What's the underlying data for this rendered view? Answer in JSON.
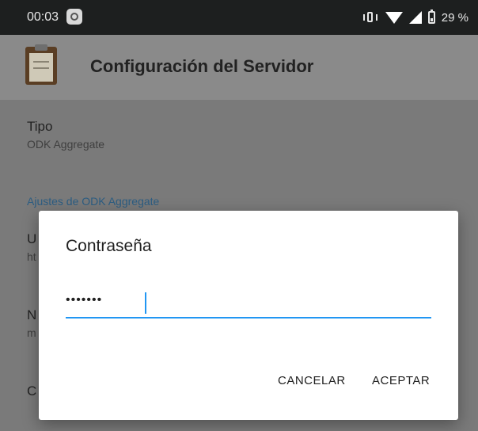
{
  "status_bar": {
    "time": "00:03",
    "battery": "29 %"
  },
  "app_bar": {
    "title": "Configuración del Servidor"
  },
  "settings": {
    "tipo": {
      "title": "Tipo",
      "summary": "ODK Aggregate"
    },
    "category": "Ajustes de ODK Aggregate",
    "url_initial": "U",
    "url_summary_initial": "ht",
    "name_initial": "N",
    "name_summary_initial": "m",
    "password_initial": "C"
  },
  "dialog": {
    "title": "Contraseña",
    "value": "•••••••",
    "cancel_label": "CANCELAR",
    "accept_label": "ACEPTAR"
  },
  "colors": {
    "accent": "#2196f3",
    "category": "#2c5d82"
  }
}
